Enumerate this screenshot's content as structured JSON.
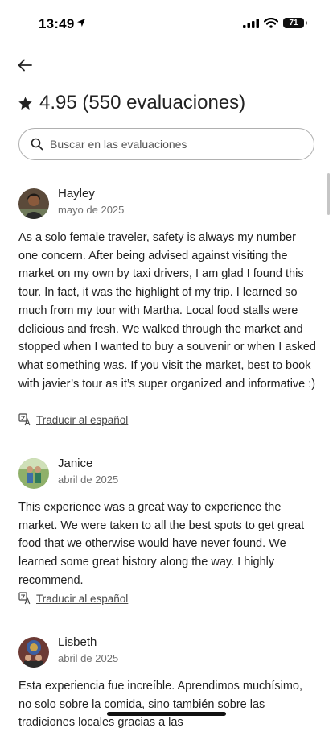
{
  "status_bar": {
    "time": "13:49",
    "battery": "71"
  },
  "header": {
    "rating_title": "4.95 (550 evaluaciones)",
    "search_placeholder": "Buscar en las evaluaciones"
  },
  "reviews": [
    {
      "name": "Hayley",
      "date": "mayo de 2025",
      "text": "As a solo female traveler, safety is always my number one concern. After being advised against visiting the market on my own by taxi drivers, I am glad I found this tour. In fact, it was the highlight of my trip. I learned so much from my tour with Martha. Local food stalls were delicious and fresh. We walked through the market and stopped when I wanted to buy a souvenir or when I asked what something was. If you visit the market, best to book with javier’s tour as it’s super organized and informative  :)",
      "translate_label": "Traducir al español"
    },
    {
      "name": "Janice",
      "date": "abril de 2025",
      "text": "This experience was a great way to experience the market. We were taken to all the best spots to get great food that we otherwise would have never found. We learned some great history along the way. I highly recommend.",
      "translate_label": "Traducir al español"
    },
    {
      "name": "Lisbeth",
      "date": "abril de 2025",
      "text": "Esta experiencia fue increíble. Aprendimos muchísimo, no solo sobre la comida, sino también sobre las tradiciones locales gracias a las"
    }
  ]
}
